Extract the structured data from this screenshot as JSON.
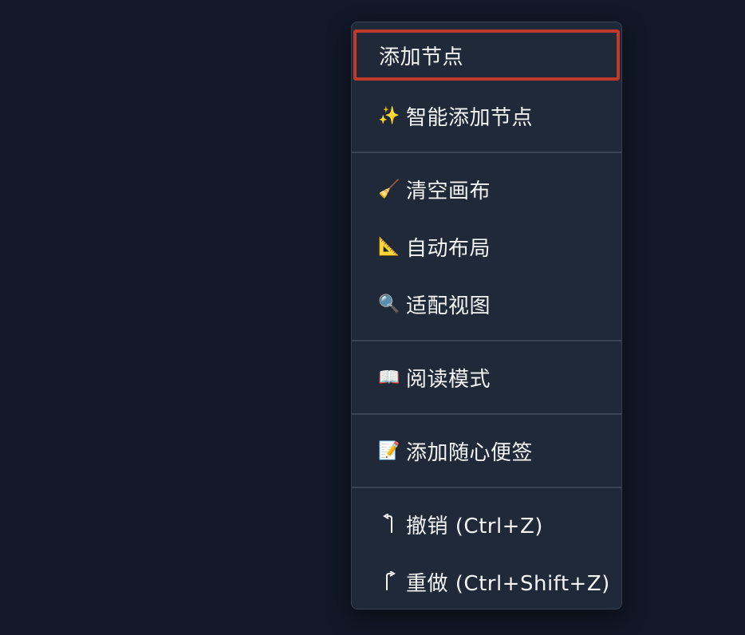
{
  "context_menu": {
    "items": [
      {
        "label": "添加节点",
        "icon": ""
      },
      {
        "label": "智能添加节点",
        "icon": "✨"
      },
      {
        "label": "清空画布",
        "icon": "🧹"
      },
      {
        "label": "自动布局",
        "icon": "📐"
      },
      {
        "label": "适配视图",
        "icon": "🔍"
      },
      {
        "label": "阅读模式",
        "icon": "📖"
      },
      {
        "label": "添加随心便签",
        "icon": "📝"
      },
      {
        "label": "撤销 (Ctrl+Z)",
        "icon": "undo-arrow-icon"
      },
      {
        "label": "重做 (Ctrl+Shift+Z)",
        "icon": "redo-arrow-icon"
      }
    ]
  },
  "colors": {
    "background": "#111827",
    "menu_background": "#1f2937",
    "highlight_border": "#c0392b",
    "text": "#f3f4f6"
  }
}
